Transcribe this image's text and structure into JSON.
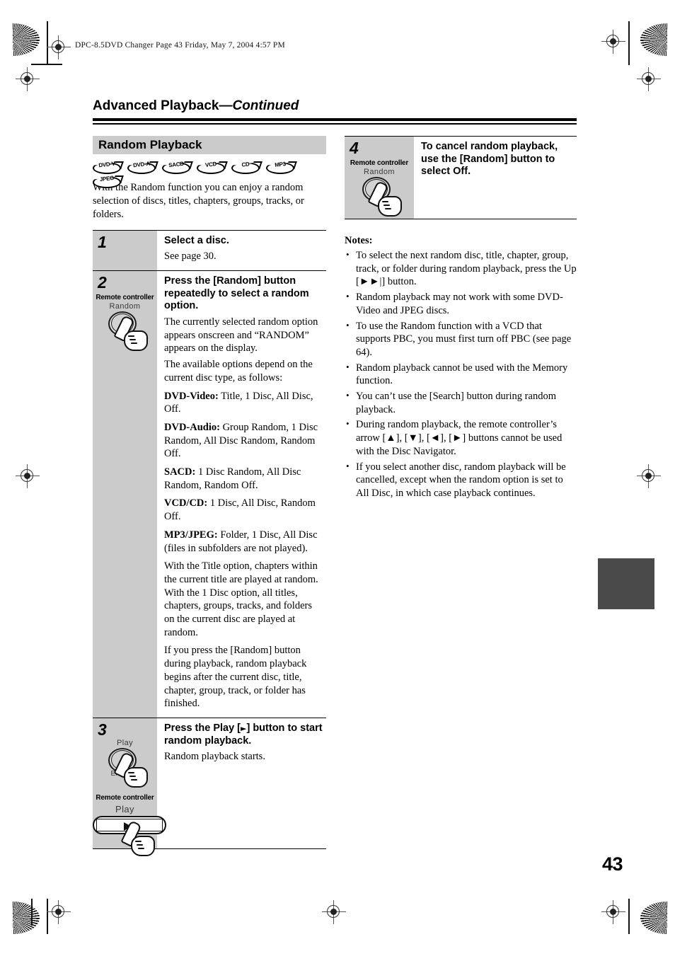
{
  "file_header": "DPC-8.5DVD Changer  Page 43  Friday, May 7, 2004  4:57 PM",
  "running_title": {
    "main": "Advanced Playback",
    "continued": "—Continued"
  },
  "folio": "43",
  "section": {
    "heading": "Random Playback",
    "disc_badges": [
      "DVD-V",
      "DVD-A",
      "SACD",
      "VCD",
      "CD",
      "MP3",
      "JPEG"
    ],
    "intro": "With the Random function you can enjoy a random selection of discs, titles, chapters, groups, tracks, or folders."
  },
  "steps": [
    {
      "number": "1",
      "heading": "Select a disc.",
      "paragraphs": [
        "See page 30."
      ],
      "remote_label": "",
      "button_caption": ""
    },
    {
      "number": "2",
      "heading": "Press the [Random] button repeatedly to select a random option.",
      "remote_label": "Remote controller",
      "button_caption": "Random",
      "paragraphs": [
        "The currently selected random option appears onscreen and “RANDOM” appears on the display.",
        "The available options depend on the current disc type, as follows:"
      ],
      "options": [
        {
          "type": "DVD-Video:",
          "values": " Title, 1 Disc, All Disc, Off."
        },
        {
          "type": "DVD-Audio:",
          "values": " Group Random, 1 Disc Random, All Disc Random, Random Off."
        },
        {
          "type": "SACD:",
          "values": " 1 Disc Random, All Disc Random, Random Off."
        },
        {
          "type": "VCD/CD:",
          "values": " 1 Disc, All Disc, Random Off."
        },
        {
          "type": "MP3/JPEG:",
          "values": " Folder, 1 Disc, All Disc (files in subfolders are not played)."
        }
      ],
      "tail_paragraphs": [
        "With the Title option, chapters within the current title are played at random. With the 1 Disc option, all titles, chapters, groups, tracks, and folders on the current disc are played at random.",
        "If you press the [Random] button during playback, random playback begins after the current disc, title, chapter, group, track, or folder has finished."
      ]
    },
    {
      "number": "3",
      "heading_prefix": "Press the Play [",
      "heading_glyph": "►",
      "heading_suffix": "] button to start random playback.",
      "paragraphs": [
        "Random playback starts."
      ],
      "knob_caption_top": "Play",
      "knob_caption_bottom": "Enter",
      "remote_label": "Remote controller",
      "bar_caption": "Play"
    }
  ],
  "step4": {
    "number": "4",
    "remote_label": "Remote controller",
    "button_caption": "Random",
    "heading": "To cancel random playback, use the [Random] button to select Off."
  },
  "notes": {
    "heading": "Notes:",
    "items": [
      "To select the next random disc, title, chapter, group, track, or folder during random playback, press the Up [►►|] button.",
      "Random playback may not work with some DVD-Video and JPEG discs.",
      "To use the Random function with a VCD that supports PBC, you must first turn off PBC (see page 64).",
      "Random playback cannot be used with the Memory function.",
      "You can’t use the [Search] button during random playback.",
      "During random playback, the remote controller’s arrow [▲], [▼], [◄], [►] buttons cannot be used with the Disc Navigator.",
      "If you select another disc, random playback will be cancelled, except when the random option is set to All Disc, in which case playback continues."
    ]
  },
  "colors": {
    "bar_gray": "#cbcbcb",
    "tab_dark": "#4a4a4a"
  }
}
